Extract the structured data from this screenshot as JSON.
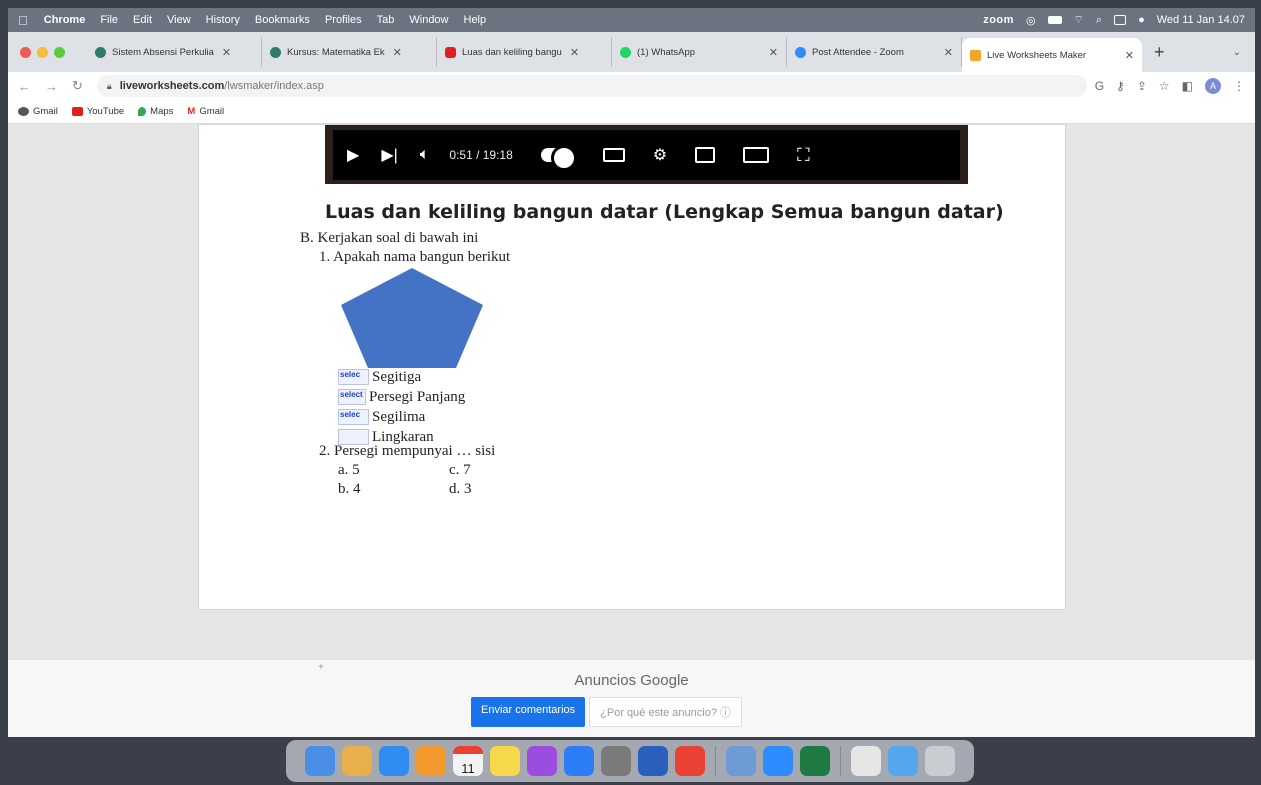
{
  "menubar": {
    "items": [
      "Chrome",
      "File",
      "Edit",
      "View",
      "History",
      "Bookmarks",
      "Profiles",
      "Tab",
      "Window",
      "Help"
    ],
    "zoom": "zoom",
    "datetime": "Wed 11 Jan  14.07"
  },
  "tabs": [
    {
      "title": "Sistem Absensi Perkulia",
      "color": "#2e7d6b"
    },
    {
      "title": "Kursus: Matematika Ek",
      "color": "#2e7d6b"
    },
    {
      "title": "Luas dan keliling bangu",
      "color": "#e02020"
    },
    {
      "title": "(1) WhatsApp",
      "color": "#25d366"
    },
    {
      "title": "Post Attendee - Zoom",
      "color": "#2d8cff"
    },
    {
      "title": "Live Worksheets Maker",
      "color": "#f4a623",
      "active": true
    }
  ],
  "toolbar": {
    "url_host": "liveworksheets.com",
    "url_path": "/lwsmaker/index.asp",
    "profile_initial": "A"
  },
  "bookmarks": [
    {
      "label": "Gmail",
      "color": "#555"
    },
    {
      "label": "YouTube",
      "color": "#e02020"
    },
    {
      "label": "Maps",
      "color": "#34a853"
    },
    {
      "label": "Gmail",
      "color": "#d93025"
    }
  ],
  "video": {
    "time": "0:51 / 19:18",
    "title": "Luas dan keliling bangun datar (Lengkap Semua bangun datar)"
  },
  "worksheet": {
    "section": "B. Kerjakan soal di bawah ini",
    "q1": "1.   Apakah nama bangun berikut",
    "shape_color": "#4472c4",
    "options": [
      {
        "select": "selec",
        "label": "Segitiga"
      },
      {
        "select": "select",
        "label": "Persegi Panjang"
      },
      {
        "select": "selec",
        "label": "Segilima"
      },
      {
        "select": "",
        "label": "Lingkaran"
      }
    ],
    "q2": "2.   Persegi mempunyai … sisi",
    "answers": [
      [
        "a.  5",
        "c. 7"
      ],
      [
        "b.  4",
        "d. 3"
      ]
    ]
  },
  "ads": {
    "label": "Anuncios Google",
    "feedback_button": "Enviar comentarios",
    "why_button": "¿Por qué este anuncio? ⓘ"
  },
  "dock": {
    "icons": [
      "finder-icon",
      "launchpad-icon",
      "safari-icon",
      "photos-icon",
      "calendar-icon",
      "notes-icon",
      "podcasts-icon",
      "appstore-icon",
      "settings-icon",
      "word-icon",
      "chrome-icon",
      "preview-icon",
      "zoom-icon",
      "excel-icon",
      "downloads-icon",
      "folder-icon",
      "trash-icon"
    ],
    "colors": [
      "#4a8fe7",
      "#e8b04a",
      "#2f8cf0",
      "#f29a2e",
      "#f2f2f2",
      "#f5d94a",
      "#9b4de0",
      "#2d7df6",
      "#7a7a7a",
      "#2b5fbe",
      "#e94235",
      "#6e9ad6",
      "#2d8cff",
      "#1f7a43",
      "#e6e6e6",
      "#56a6ee",
      "#c9cdd2"
    ],
    "calendar_day": "11"
  }
}
